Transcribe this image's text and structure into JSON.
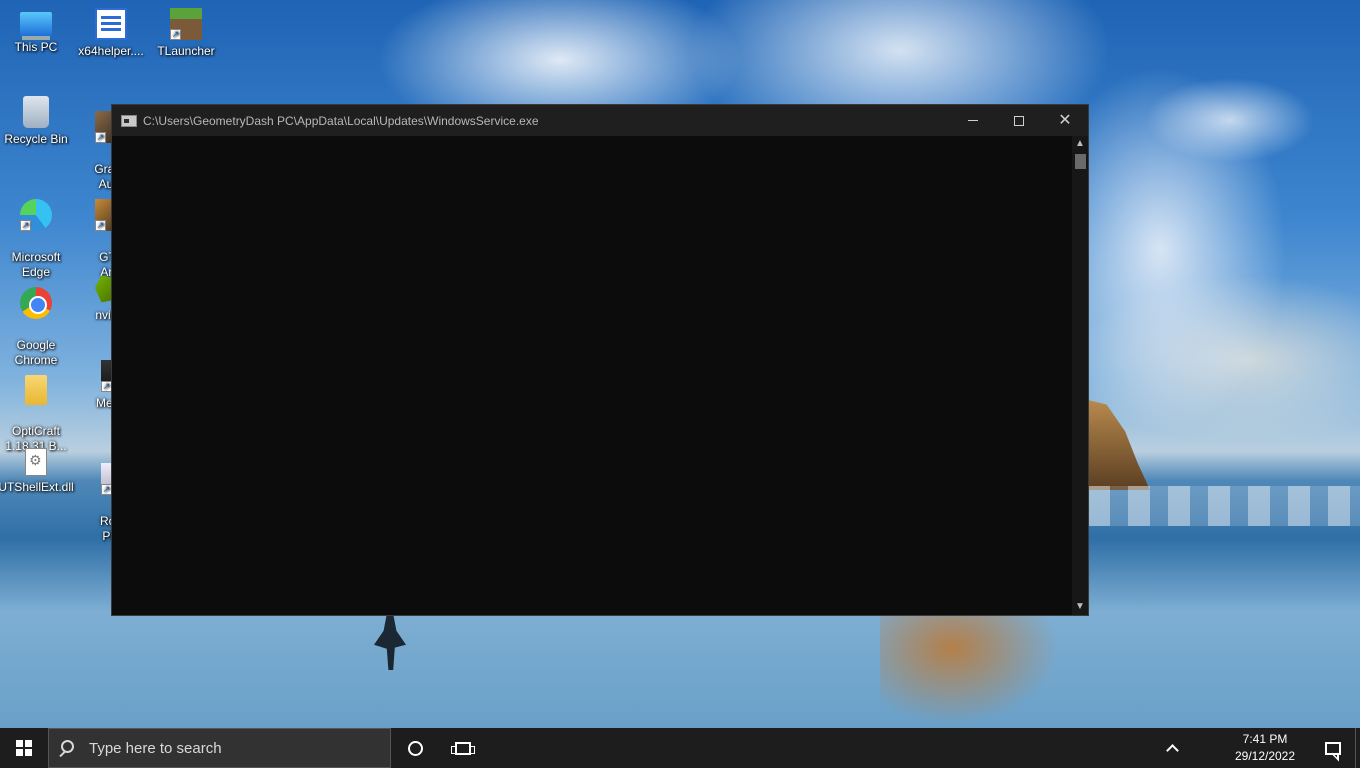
{
  "desktop": {
    "icons": [
      {
        "label": "This PC",
        "icon": "this-pc-icon"
      },
      {
        "label": "x64helper....",
        "icon": "x64helper-icon"
      },
      {
        "label": "TLauncher",
        "icon": "tlauncher-icon"
      },
      {
        "label": "Recycle Bin",
        "icon": "recycle-bin-icon"
      },
      {
        "label": "Grand\nAuto",
        "icon": "gta-icon"
      },
      {
        "label": "Microsoft\nEdge",
        "icon": "edge-icon"
      },
      {
        "label": "GTA\nAnd",
        "icon": "gta-sa-icon"
      },
      {
        "label": "Google\nChrome",
        "icon": "chrome-icon"
      },
      {
        "label": "nvidia",
        "icon": "nvidia-icon"
      },
      {
        "label": "OptiCraft\n1.18.31 B...",
        "icon": "folder-icon"
      },
      {
        "label": "Mega",
        "icon": "mega-icon"
      },
      {
        "label": "UTShellExt.dll",
        "icon": "dll-file-icon"
      },
      {
        "label": "Rob\nPla",
        "icon": "roblox-icon"
      }
    ]
  },
  "console_window": {
    "title": "C:\\Users\\GeometryDash PC\\AppData\\Local\\Updates\\WindowsService.exe",
    "icon": "console-app-icon",
    "minimize": "minimize",
    "maximize": "maximize",
    "close": "close"
  },
  "taskbar": {
    "search_placeholder": "Type here to search",
    "clock_time": "7:41 PM",
    "clock_date": "29/12/2022",
    "icons": [
      "windows-start-icon",
      "search-icon",
      "cortana-icon",
      "task-view-icon",
      "show-hidden-icons-chevron",
      "notifications-icon"
    ]
  },
  "colors": {
    "taskbar_bg": "#1d1d1d",
    "console_bg": "#0c0c0c",
    "titlebar_bg": "#1f1f1f"
  }
}
